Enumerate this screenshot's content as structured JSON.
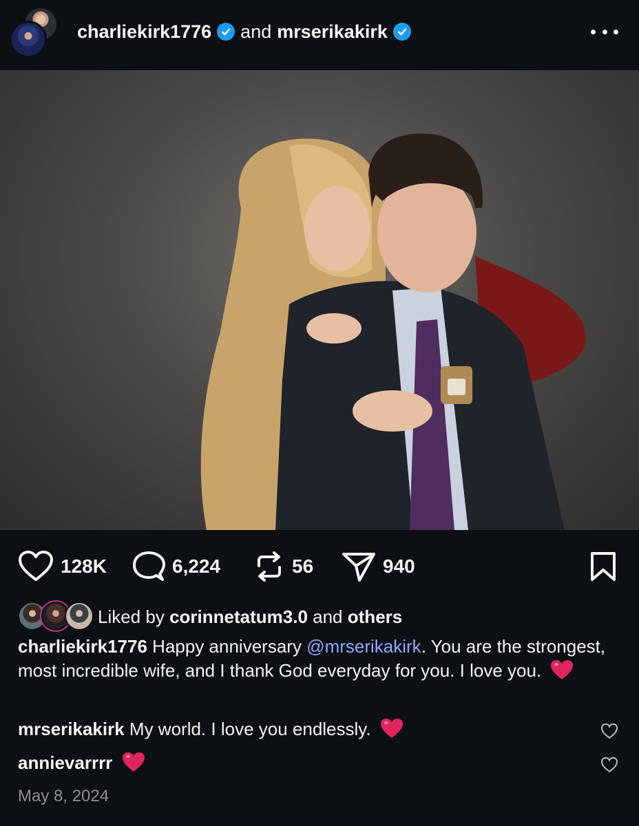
{
  "header": {
    "author": "charliekirk1776",
    "connector": "and",
    "coauthor": "mrserikakirk"
  },
  "actions": {
    "likes": "128K",
    "comments": "6,224",
    "reposts": "56",
    "shares": "940"
  },
  "likes_line": {
    "prefix": "Liked by",
    "user": "corinnetatum3.0",
    "connector": "and",
    "others": "others"
  },
  "caption": {
    "username": "charliekirk1776",
    "text_before": "Happy anniversary",
    "mention": "@mrserikakirk",
    "text_after": ". You are the strongest, most incredible wife, and I thank God everyday for you. I love you."
  },
  "comments": [
    {
      "username": "mrserikakirk",
      "text": "My world. I love you endlessly."
    },
    {
      "username": "annievarrrr",
      "text": ""
    }
  ],
  "date": "May 8, 2024",
  "colors": {
    "background": "#0c1014",
    "verified": "#1d9bf0",
    "mention": "#8fa8ff",
    "heart_emoji": "#e0245e"
  }
}
